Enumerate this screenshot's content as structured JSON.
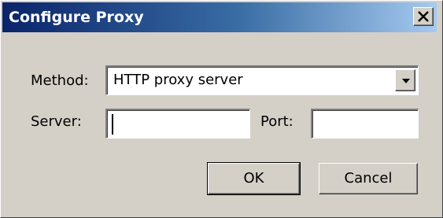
{
  "window": {
    "title": "Configure Proxy",
    "close_icon": "close-icon"
  },
  "form": {
    "method_label": "Method:",
    "method_value": "HTTP proxy server",
    "server_label": "Server:",
    "server_value": "",
    "port_label": "Port:",
    "port_value": ""
  },
  "buttons": {
    "ok_label": "OK",
    "cancel_label": "Cancel"
  }
}
